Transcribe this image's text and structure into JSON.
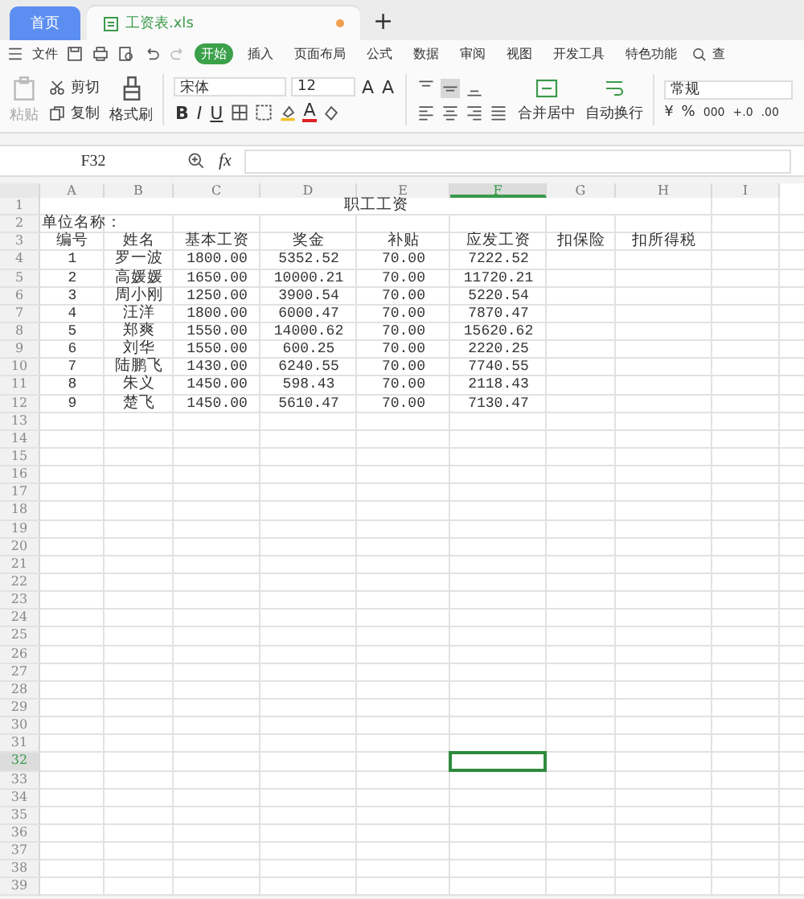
{
  "tabs": [
    {
      "label": "首页",
      "kind": "home",
      "selected": false
    },
    {
      "label": "工资表.xls",
      "kind": "file",
      "selected": true
    }
  ],
  "new_tab": "+",
  "menu": {
    "file": "文件",
    "items": [
      {
        "label": "开始",
        "selected": true
      },
      {
        "label": "插入",
        "selected": false
      },
      {
        "label": "页面布局",
        "selected": false
      },
      {
        "label": "公式",
        "selected": false
      },
      {
        "label": "数据",
        "selected": false
      },
      {
        "label": "审阅",
        "selected": false
      },
      {
        "label": "视图",
        "selected": false
      },
      {
        "label": "开发工具",
        "selected": false
      },
      {
        "label": "特色功能",
        "selected": false
      }
    ],
    "search": "查"
  },
  "toolbar": {
    "paste": "粘贴",
    "cut": "剪切",
    "copy": "复制",
    "format_painter": "格式刷",
    "font": "宋体",
    "font_size": "12",
    "grow_font": "A",
    "shrink_font": "A",
    "bold": "B",
    "italic": "I",
    "underline": "U",
    "font_color": "A",
    "vertical_align": [
      {
        "kind": "top",
        "selected": false
      },
      {
        "kind": "middle",
        "selected": true
      },
      {
        "kind": "bottom",
        "selected": false
      }
    ],
    "horizontal_align": [
      {
        "kind": "left",
        "selected": false
      },
      {
        "kind": "center",
        "selected": false
      },
      {
        "kind": "right",
        "selected": false
      },
      {
        "kind": "justify",
        "selected": false
      }
    ],
    "merge": "合并居中",
    "wrap": "自动换行",
    "number_format": "常规",
    "currency": "¥",
    "percent": "%",
    "thousands": "000",
    "add_decimal": "+.0",
    "remove_decimal": ".00"
  },
  "formula_bar": {
    "name_box": "F32",
    "fx": "fx"
  },
  "sheet": {
    "columns": [
      {
        "label": "A",
        "selected": false
      },
      {
        "label": "B",
        "selected": false
      },
      {
        "label": "C",
        "selected": false
      },
      {
        "label": "D",
        "selected": false
      },
      {
        "label": "E",
        "selected": false
      },
      {
        "label": "F",
        "selected": true
      },
      {
        "label": "G",
        "selected": false
      },
      {
        "label": "H",
        "selected": false
      },
      {
        "label": "I",
        "selected": false
      }
    ],
    "title": "职工工资",
    "unit_label": "单位名称：",
    "header": [
      "编号",
      "姓名",
      "基本工资",
      "奖金",
      "补贴",
      "应发工资",
      "扣保险",
      "扣所得税"
    ],
    "rows": [
      [
        "1",
        "罗一波",
        "1800.00",
        "5352.52",
        "70.00",
        "7222.52"
      ],
      [
        "2",
        "高媛媛",
        "1650.00",
        "10000.21",
        "70.00",
        "11720.21"
      ],
      [
        "3",
        "周小刚",
        "1250.00",
        "3900.54",
        "70.00",
        "5220.54"
      ],
      [
        "4",
        "汪洋",
        "1800.00",
        "6000.47",
        "70.00",
        "7870.47"
      ],
      [
        "5",
        "郑爽",
        "1550.00",
        "14000.62",
        "70.00",
        "15620.62"
      ],
      [
        "6",
        "刘华",
        "1550.00",
        "600.25",
        "70.00",
        "2220.25"
      ],
      [
        "7",
        "陆鹏飞",
        "1430.00",
        "6240.55",
        "70.00",
        "7740.55"
      ],
      [
        "8",
        "朱义",
        "1450.00",
        "598.43",
        "70.00",
        "2118.43"
      ],
      [
        "9",
        "楚飞",
        "1450.00",
        "5610.47",
        "70.00",
        "7130.47"
      ]
    ],
    "row_numbers": [
      {
        "label": "1",
        "selected": false
      },
      {
        "label": "2",
        "selected": false
      },
      {
        "label": "3",
        "selected": false
      },
      {
        "label": "4",
        "selected": false
      },
      {
        "label": "5",
        "selected": false
      },
      {
        "label": "6",
        "selected": false
      },
      {
        "label": "7",
        "selected": false
      },
      {
        "label": "8",
        "selected": false
      },
      {
        "label": "9",
        "selected": false
      },
      {
        "label": "10",
        "selected": false
      },
      {
        "label": "11",
        "selected": false
      },
      {
        "label": "12",
        "selected": false
      },
      {
        "label": "13",
        "selected": false
      },
      {
        "label": "14",
        "selected": false
      },
      {
        "label": "15",
        "selected": false
      },
      {
        "label": "16",
        "selected": false
      },
      {
        "label": "17",
        "selected": false
      },
      {
        "label": "18",
        "selected": false
      },
      {
        "label": "19",
        "selected": false
      },
      {
        "label": "20",
        "selected": false
      },
      {
        "label": "21",
        "selected": false
      },
      {
        "label": "22",
        "selected": false
      },
      {
        "label": "23",
        "selected": false
      },
      {
        "label": "24",
        "selected": false
      },
      {
        "label": "25",
        "selected": false
      },
      {
        "label": "26",
        "selected": false
      },
      {
        "label": "27",
        "selected": false
      },
      {
        "label": "28",
        "selected": false
      },
      {
        "label": "29",
        "selected": false
      },
      {
        "label": "30",
        "selected": false
      },
      {
        "label": "31",
        "selected": false
      },
      {
        "label": "32",
        "selected": true
      },
      {
        "label": "33",
        "selected": false
      },
      {
        "label": "34",
        "selected": false
      },
      {
        "label": "35",
        "selected": false
      },
      {
        "label": "36",
        "selected": false
      },
      {
        "label": "37",
        "selected": false
      },
      {
        "label": "38",
        "selected": false
      },
      {
        "label": "39",
        "selected": false
      }
    ]
  }
}
